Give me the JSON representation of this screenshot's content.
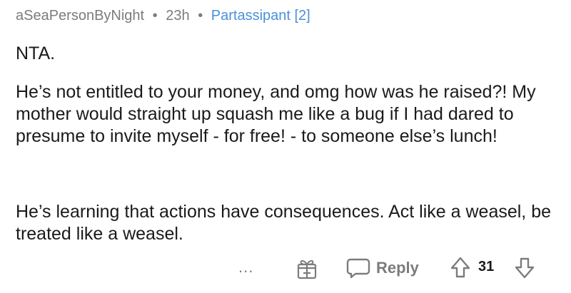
{
  "comment": {
    "author": "aSeaPersonByNight",
    "separator": "•",
    "age": "23h",
    "flair": "Partassipant [2]",
    "paragraphs": [
      "NTA.",
      "He’s not entitled to your money, and omg how was he raised?!  My mother would straight up squash me like a bug if I had dared to presume to invite myself - for free! - to someone else’s lunch!",
      "He’s learning that actions have consequences.  Act like a weasel, be treated like a weasel."
    ]
  },
  "actions": {
    "more_label": "...",
    "reply_label": "Reply",
    "score": "31",
    "icons": {
      "award": "gift-icon",
      "reply": "speech-bubble-icon",
      "upvote": "arrow-up-icon",
      "downvote": "arrow-down-icon"
    }
  },
  "colors": {
    "meta": "#7c7c7c",
    "flair": "#4a90d9",
    "text": "#1a1a1b"
  }
}
